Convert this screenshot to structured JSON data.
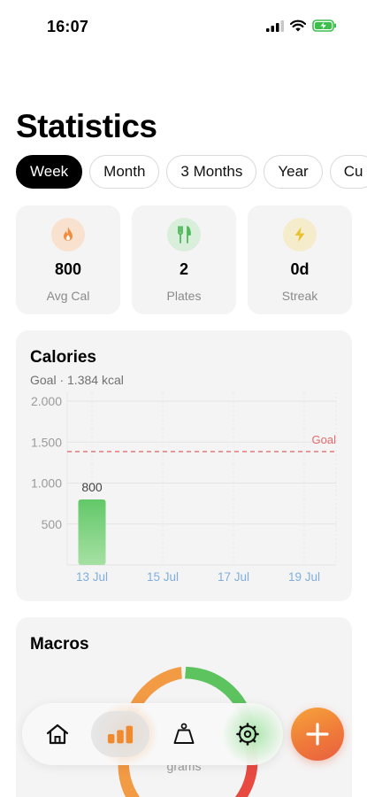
{
  "status_bar": {
    "time": "16:07"
  },
  "page_title": "Statistics",
  "tabs": [
    "Week",
    "Month",
    "3 Months",
    "Year",
    "Cu"
  ],
  "active_tab": "Week",
  "stats": [
    {
      "icon": "flame-icon",
      "value": "800",
      "label": "Avg Cal",
      "color": "#f28b3c",
      "bg": "#f8e1cf"
    },
    {
      "icon": "fork-knife-icon",
      "value": "2",
      "label": "Plates",
      "color": "#4fb85a",
      "bg": "#d9eedb"
    },
    {
      "icon": "lightning-icon",
      "value": "0d",
      "label": "Streak",
      "color": "#e9c230",
      "bg": "#f5eccb"
    }
  ],
  "calories_card": {
    "title": "Calories",
    "subtitle": "Goal · 1.384 kcal",
    "goal_label": "Goal"
  },
  "chart_data": {
    "type": "bar",
    "x_tick_labels": [
      "13 Jul",
      "15 Jul",
      "17 Jul",
      "19 Jul"
    ],
    "x_ticks": [
      13,
      15,
      17,
      19
    ],
    "xlim": [
      12.3,
      19.9
    ],
    "y_tick_labels": [
      "2.000",
      "1.500",
      "1.000",
      "500"
    ],
    "y_ticks": [
      2000,
      1500,
      1000,
      500
    ],
    "ylim": [
      0,
      2000
    ],
    "bars": [
      {
        "x": 13,
        "value": 800,
        "label": "800"
      }
    ],
    "goal_line": 1384,
    "grid": true,
    "colors": {
      "bar_top": "#62c868",
      "bar_bottom": "#a6e0a4",
      "goal": "#e26d6d",
      "tick_x": "#7faede",
      "tick_y": "#9a9a9a"
    }
  },
  "macros_card": {
    "title": "Macros",
    "unit_label": "grams",
    "colors": {
      "carbs": "#f39a45",
      "protein": "#5dc35f",
      "fat": "#e84a42"
    }
  },
  "nav": {
    "items": [
      "home-icon",
      "stats-icon",
      "scale-icon",
      "settings-icon"
    ],
    "active": "stats-icon"
  },
  "fab": {
    "icon": "plus-icon"
  }
}
